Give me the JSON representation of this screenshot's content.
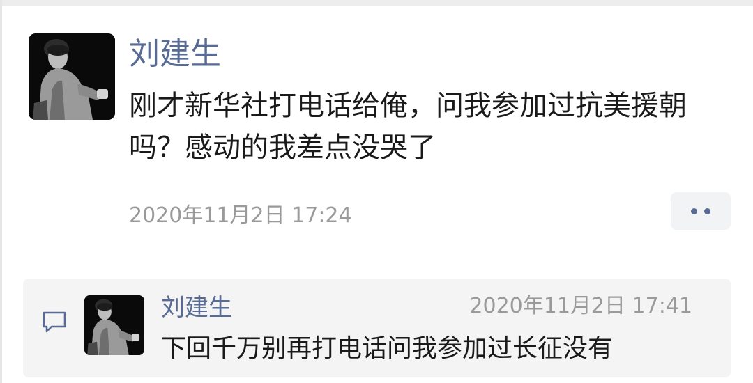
{
  "post": {
    "author": "刘建生",
    "content": "刚才新华社打电话给俺，问我参加过抗美援朝吗？感动的我差点没哭了",
    "timestamp": "2020年11月2日 17:24",
    "avatar_icon": "user-photo-avatar",
    "more_icon": "two-dots-icon"
  },
  "comment": {
    "author": "刘建生",
    "timestamp": "2020年11月2日 17:41",
    "text": "下回千万别再打电话问我参加过长征没有",
    "avatar_icon": "user-photo-avatar",
    "comment_icon": "comment-bubble-icon"
  },
  "colors": {
    "name_link": "#576b95",
    "timestamp": "#9a9a9a",
    "comment_bg": "#f4f4f4",
    "body_text": "#1a1a1a"
  }
}
